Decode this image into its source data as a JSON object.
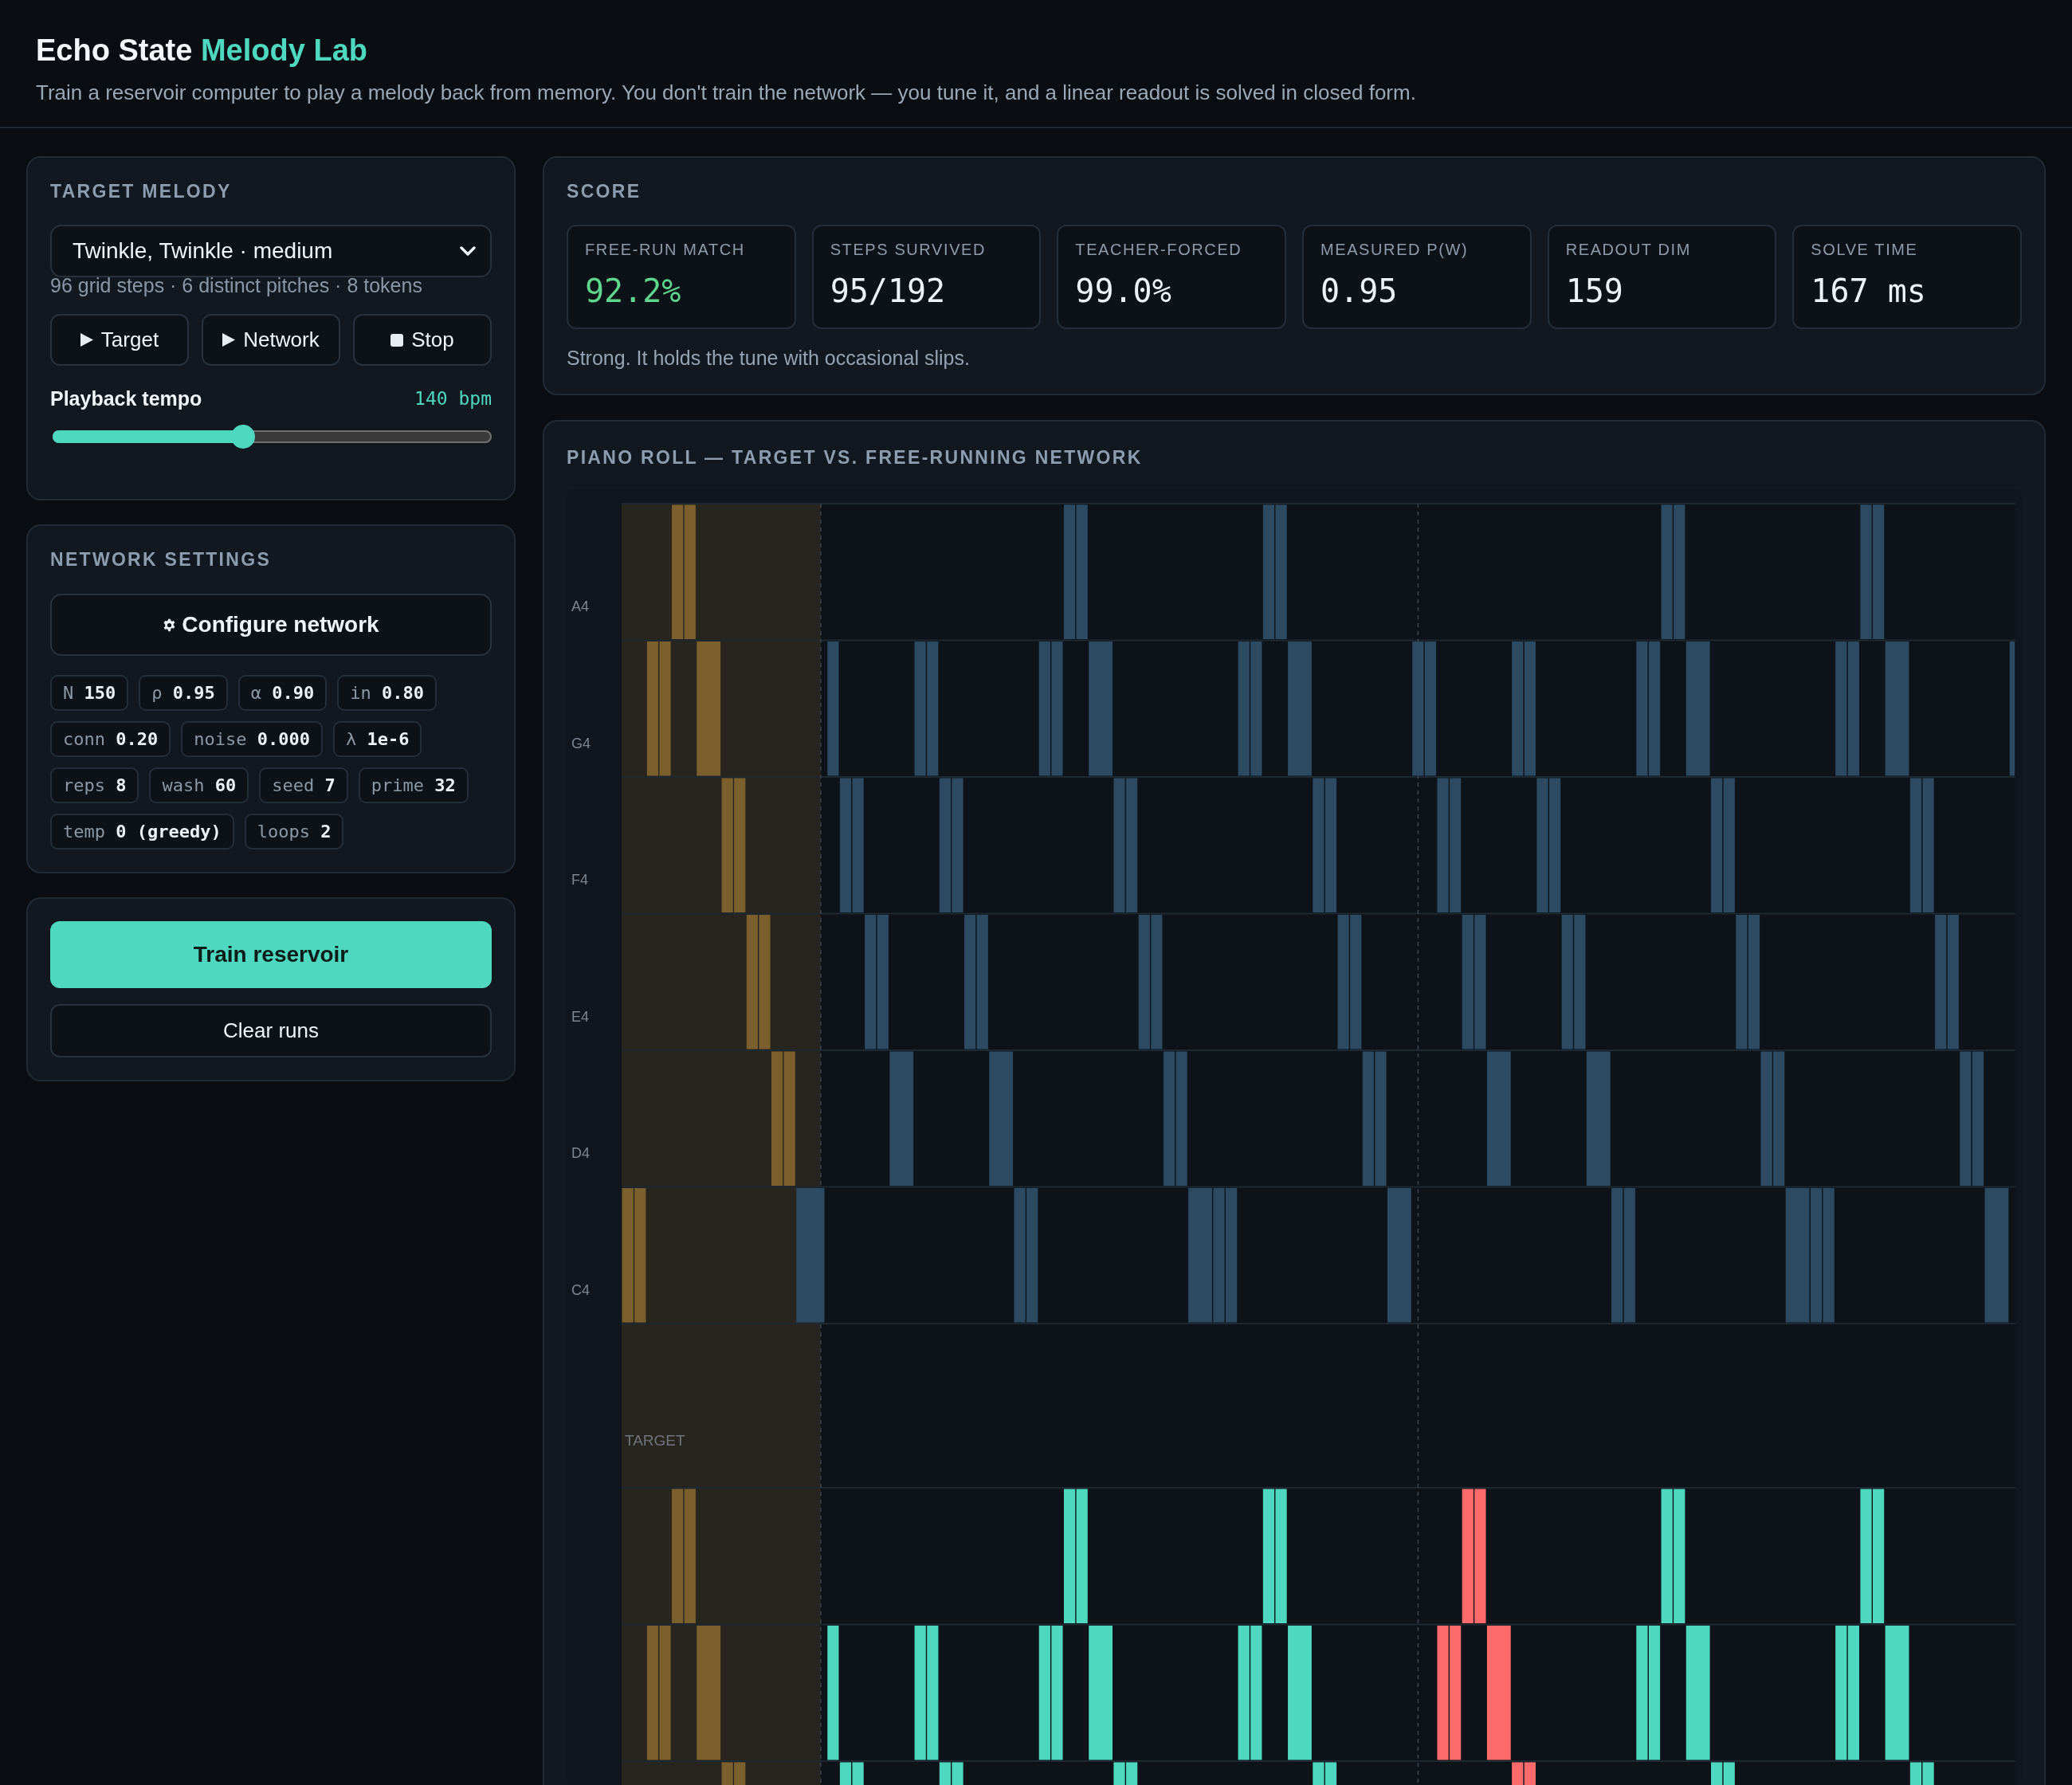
{
  "header": {
    "title": "Echo State",
    "title_accent": "Melody Lab",
    "subtitle": "Train a reservoir computer to play a melody back from memory. You don't train the network — you tune it, and a linear readout is solved in closed form."
  },
  "target_melody": {
    "heading": "TARGET MELODY",
    "melody": "Twinkle, Twinkle · medium",
    "info": "96 grid steps · 6 distinct pitches · 8 tokens",
    "buttons": [
      {
        "kind": "play",
        "label": "Target"
      },
      {
        "kind": "play",
        "label": "Network"
      },
      {
        "kind": "stop",
        "label": "Stop"
      }
    ],
    "tempo": {
      "label": "Playback tempo",
      "reading": "140 bpm",
      "level": 0.43
    }
  },
  "network_settings": {
    "heading": "NETWORK SETTINGS",
    "configure_button": "Configure network",
    "parameters": [
      {
        "name": "N",
        "value": "150"
      },
      {
        "name": "ρ",
        "value": "0.95"
      },
      {
        "name": "α",
        "value": "0.90"
      },
      {
        "name": "in",
        "value": "0.80"
      },
      {
        "name": "conn",
        "value": "0.20"
      },
      {
        "name": "noise",
        "value": "0.000"
      },
      {
        "name": "λ",
        "value": "1e-6"
      },
      {
        "name": "reps",
        "value": "8"
      },
      {
        "name": "wash",
        "value": "60"
      },
      {
        "name": "seed",
        "value": "7"
      },
      {
        "name": "prime",
        "value": "32"
      },
      {
        "name": "temp",
        "value": "0 (greedy)"
      },
      {
        "name": "loops",
        "value": "2"
      }
    ]
  },
  "actions": {
    "train_button": "Train reservoir",
    "clear_button": "Clear runs"
  },
  "score": {
    "heading": "SCORE",
    "metrics": [
      {
        "label": "FREE-RUN MATCH",
        "value": "92.2%",
        "color": "#5ed68c"
      },
      {
        "label": "STEPS SURVIVED",
        "value": "95/192",
        "color": "#eef2f6"
      },
      {
        "label": "TEACHER-FORCED",
        "value": "99.0%",
        "color": "#eef2f6"
      },
      {
        "label": "MEASURED P(W)",
        "value": "0.95",
        "color": "#eef2f6"
      },
      {
        "label": "READOUT DIM",
        "value": "159",
        "color": "#eef2f6"
      },
      {
        "label": "SOLVE TIME",
        "value": "167 ms",
        "color": "#eef2f6"
      }
    ],
    "verdict": "Strong. It holds the tune with occasional slips."
  },
  "piano_roll": {
    "heading": "PIANO ROLL — TARGET VS. FREE-RUNNING NETWORK",
    "pitches": [
      "A4",
      "G4",
      "F4",
      "E4",
      "D4",
      "C4"
    ],
    "target_label": "TARGET"
  }
}
